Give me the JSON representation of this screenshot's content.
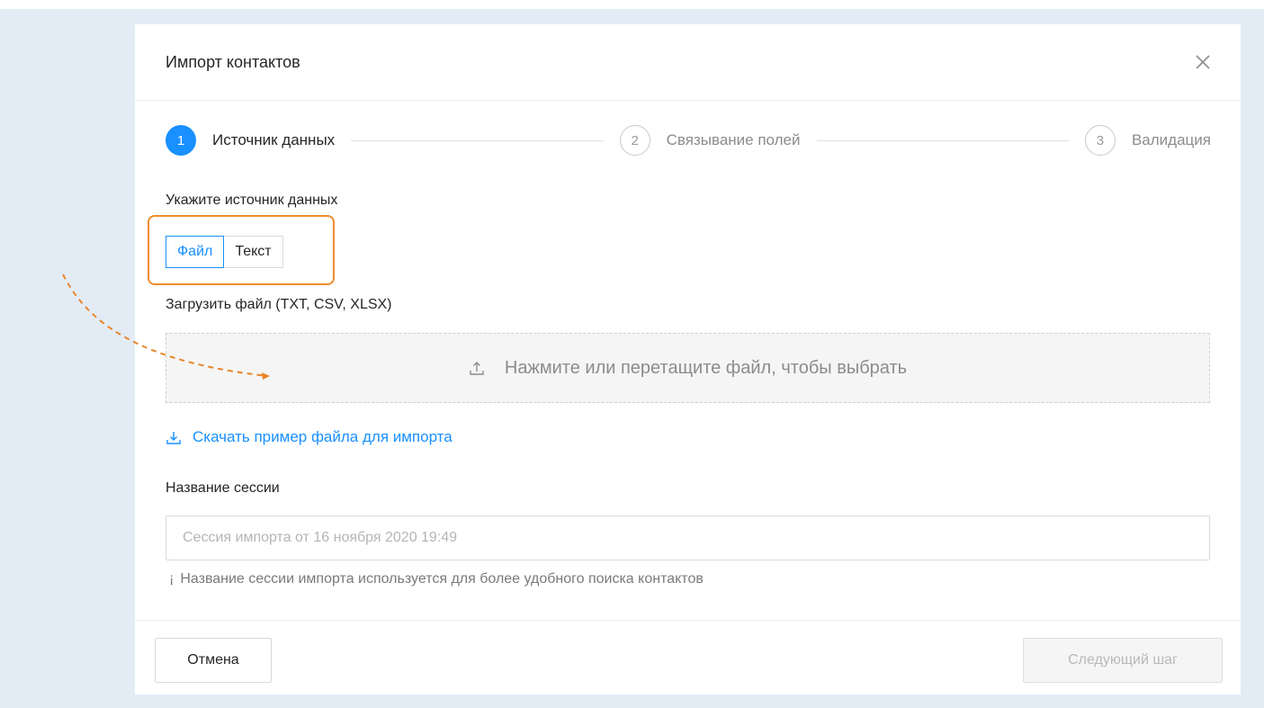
{
  "modal": {
    "title": "Импорт контактов"
  },
  "steps": [
    {
      "number": "1",
      "label": "Источник данных",
      "state": "active"
    },
    {
      "number": "2",
      "label": "Связывание полей",
      "state": "wait"
    },
    {
      "number": "3",
      "label": "Валидация",
      "state": "wait"
    }
  ],
  "source": {
    "label": "Укажите источник данных",
    "options": [
      "Файл",
      "Текст"
    ],
    "selected": "Файл"
  },
  "upload": {
    "label": "Загрузить файл (TXT, CSV, XLSX)",
    "dropzone_text": "Нажмите или перетащите файл, чтобы выбрать"
  },
  "download_example": {
    "label": "Скачать пример файла для импорта"
  },
  "session": {
    "label": "Название сессии",
    "value": "",
    "placeholder": "Сессия импорта от 16 ноября 2020 19:49",
    "hint": "Название сессии импорта используется для более удобного поиска контактов"
  },
  "footer": {
    "cancel_label": "Отмена",
    "next_label": "Следующий шаг"
  },
  "colors": {
    "accent": "#1890ff",
    "highlight": "#f08c2e",
    "backdrop": "#e3ecf5"
  }
}
